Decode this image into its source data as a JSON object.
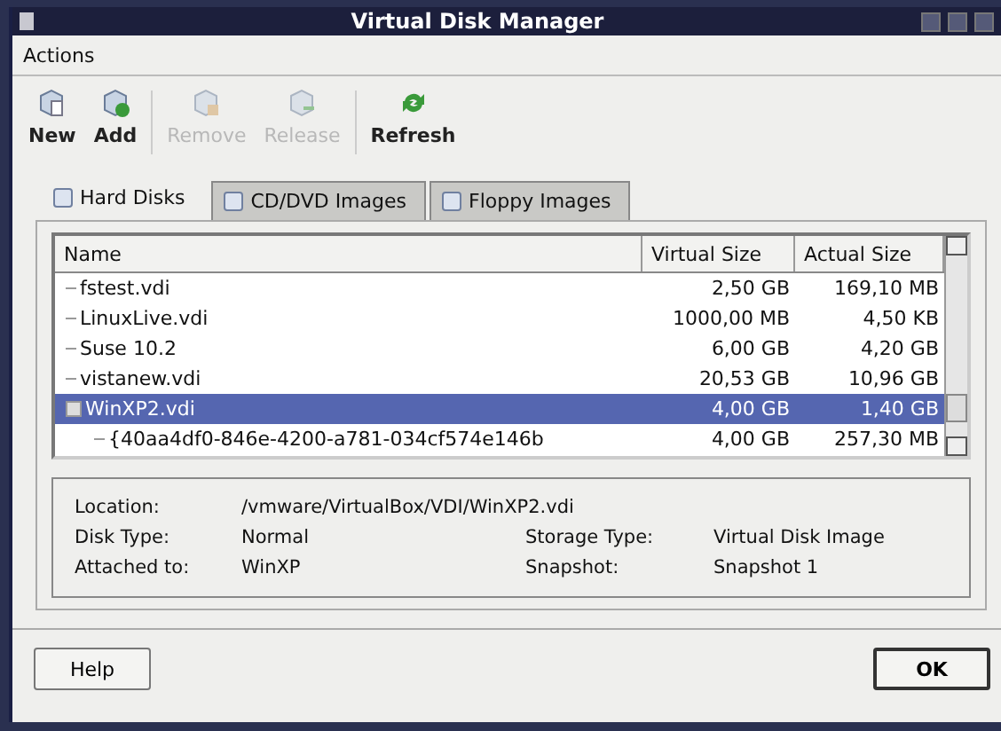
{
  "window": {
    "title": "Virtual Disk Manager"
  },
  "menu": [
    {
      "label": "Actions"
    }
  ],
  "toolbar": [
    {
      "label": "New",
      "disabled": false
    },
    {
      "label": "Add",
      "disabled": false
    },
    {
      "label": "Remove",
      "disabled": true
    },
    {
      "label": "Release",
      "disabled": true
    },
    {
      "label": "Refresh",
      "disabled": false
    }
  ],
  "tabs": [
    {
      "label": "Hard Disks",
      "selected": true
    },
    {
      "label": "CD/DVD Images",
      "selected": false
    },
    {
      "label": "Floppy Images",
      "selected": false
    }
  ],
  "table": {
    "columns": [
      "Name",
      "Virtual Size",
      "Actual Size"
    ],
    "rows": [
      {
        "name": "fstest.vdi",
        "virtual": "2,50 GB",
        "actual": "169,10 MB",
        "selected": false
      },
      {
        "name": "LinuxLive.vdi",
        "virtual": "1000,00 MB",
        "actual": "4,50 KB",
        "selected": false
      },
      {
        "name": "Suse 10.2",
        "virtual": "6,00 GB",
        "actual": "4,20 GB",
        "selected": false
      },
      {
        "name": "vistanew.vdi",
        "virtual": "20,53 GB",
        "actual": "10,96 GB",
        "selected": false
      },
      {
        "name": "WinXP2.vdi",
        "virtual": "4,00 GB",
        "actual": "1,40 GB",
        "selected": true,
        "expanded": true,
        "children": [
          {
            "name": "{40aa4df0-846e-4200-a781-034cf574e146b",
            "virtual": "4,00 GB",
            "actual": "257,30 MB",
            "selected": false
          }
        ]
      }
    ]
  },
  "details": [
    {
      "label": "Location:",
      "value": "/vmware/VirtualBox/VDI/WinXP2.vdi"
    },
    {
      "label": "Disk Type:",
      "value": "Normal",
      "label2": "Storage Type:",
      "value2": "Virtual Disk Image"
    },
    {
      "label": "Attached to:",
      "value": "WinXP",
      "label2": "Snapshot:",
      "value2": "Snapshot 1"
    }
  ],
  "buttons": [
    {
      "label": "Help",
      "default": false
    },
    {
      "label": "OK",
      "default": true
    }
  ]
}
